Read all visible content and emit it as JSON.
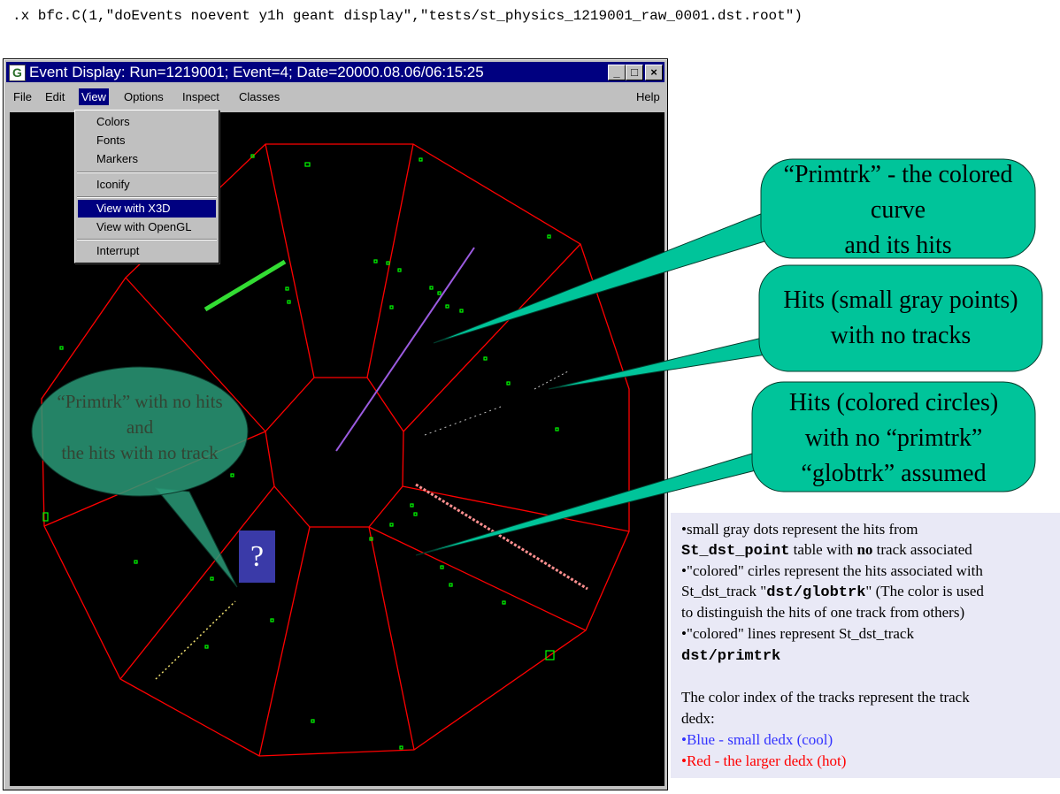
{
  "command": ".x bfc.C(1,\"doEvents noevent y1h geant display\",\"tests/st_physics_1219001_raw_0001.dst.root\")",
  "window": {
    "title": "Event Display: Run=1219001; Event=4; Date=20000.08.06/06:15:25",
    "app_icon": "G",
    "buttons": {
      "minimize": "_",
      "maximize": "□",
      "close": "×"
    }
  },
  "menubar": {
    "file": "File",
    "edit": "Edit",
    "view": "View",
    "options": "Options",
    "inspect": "Inspect",
    "classes": "Classes",
    "help": "Help"
  },
  "view_menu": {
    "items": [
      "Colors",
      "Fonts",
      "Markers",
      "Iconify",
      "View with X3D",
      "View with OpenGL",
      "Interrupt"
    ],
    "selected": "View with X3D"
  },
  "callouts": {
    "primtrk": [
      "“Primtrk” - the colored",
      "curve",
      "and its hits"
    ],
    "gray_hits": [
      "Hits (small gray points)",
      "with no tracks"
    ],
    "colored_hits": [
      "Hits (colored circles)",
      "with no “primtrk”",
      "“globtrk” assumed"
    ],
    "no_hits": [
      "“Primtrk” with no hits",
      "and",
      "the hits with no track"
    ]
  },
  "question_mark": "?",
  "notes": {
    "line1_a": "•small gray dots represent the hits from",
    "line2_code": "St_dst_point",
    "line2_a": " table with ",
    "line2_bold": "no",
    "line2_b": " track associated",
    "line3": "•\"colored\" cirles represent the hits associated with",
    "line4_a": "St_dst_track \"",
    "line4_code": "dst/globtrk",
    "line4_b": "\"  (The color is used",
    "line5": "to distinguish the hits of one track from others)",
    "line6": "•\"colored\" lines represent  St_dst_track",
    "line7_code": "dst/primtrk",
    "line8": "The color index of the tracks represent the track",
    "line9": "dedx:",
    "blue": "•Blue - small dedx (cool)",
    "red": "•Red -  the larger dedx (hot)"
  },
  "colors": {
    "detector": "#ff0000",
    "hits": "#00ff00",
    "callout": "#00c49a",
    "callout_faded": "#2a9a78",
    "blue_note": "#3333ff",
    "red_note": "#ff0000"
  }
}
